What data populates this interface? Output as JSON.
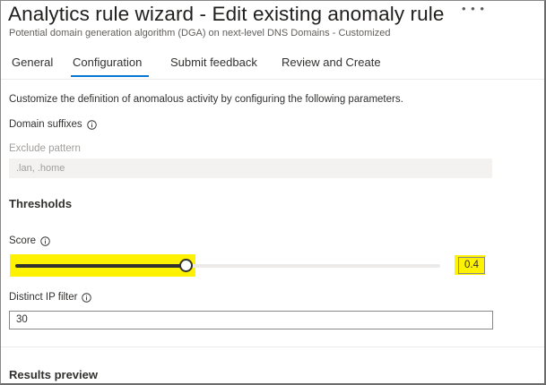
{
  "header": {
    "title": "Analytics rule wizard - Edit existing anomaly rule",
    "more_icon": "ellipsis-icon",
    "subtitle": "Potential domain generation algorithm (DGA) on next-level DNS Domains - Customized"
  },
  "tabs": [
    {
      "label": "General"
    },
    {
      "label": "Configuration",
      "active": true
    },
    {
      "label": "Submit feedback"
    },
    {
      "label": "Review and Create"
    }
  ],
  "main": {
    "description": "Customize the definition of anomalous activity by configuring the following parameters.",
    "domain_suffixes_label": "Domain suffixes",
    "exclude_pattern": {
      "label": "Exclude pattern",
      "placeholder": ".lan, .home"
    },
    "thresholds_title": "Thresholds",
    "score": {
      "label": "Score",
      "value": "0.4",
      "fraction": 0.4
    },
    "distinct_ip_filter": {
      "label": "Distinct IP filter",
      "value": "30"
    },
    "results_preview_title": "Results preview"
  },
  "colors": {
    "accent": "#0078d4",
    "highlight": "#fff200"
  }
}
